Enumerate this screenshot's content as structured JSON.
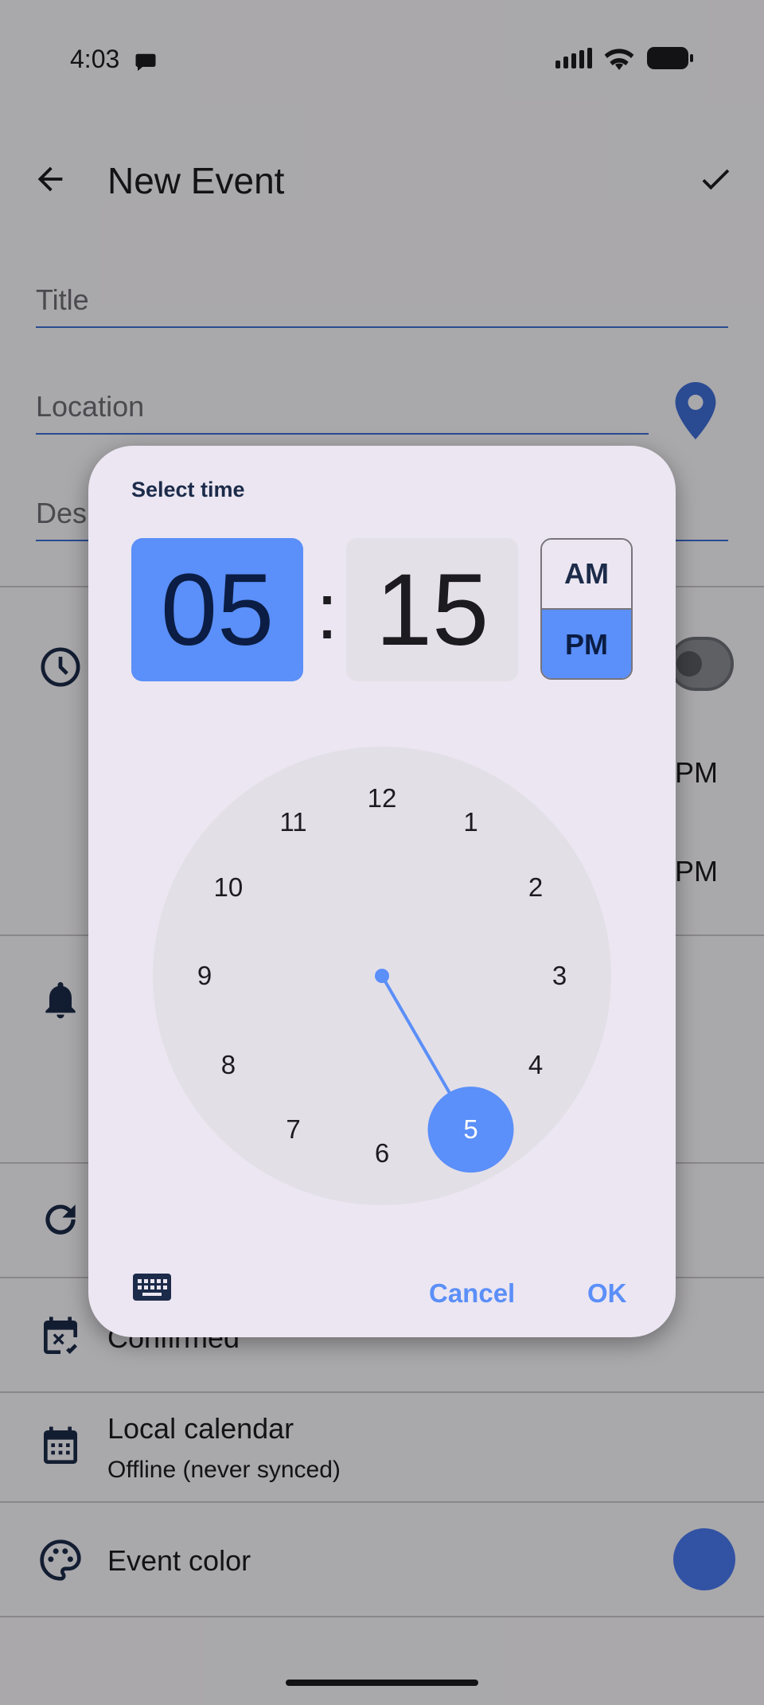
{
  "status_bar": {
    "time": "4:03"
  },
  "app_bar": {
    "title": "New Event"
  },
  "form": {
    "title_placeholder": "Title",
    "location_placeholder": "Location",
    "description_placeholder": "Des"
  },
  "times": {
    "start_suffix": "PM",
    "end_suffix": "PM"
  },
  "status_row": {
    "label": "Confirmed"
  },
  "calendar_row": {
    "title": "Local calendar",
    "subtitle": "Offline (never synced)"
  },
  "color_row": {
    "label": "Event color",
    "color": "#4a7af2"
  },
  "dialog": {
    "title": "Select time",
    "hour": "05",
    "separator": ":",
    "minute": "15",
    "am_label": "AM",
    "pm_label": "PM",
    "period_selected": "PM",
    "clock_numbers": [
      "12",
      "1",
      "2",
      "3",
      "4",
      "5",
      "6",
      "7",
      "8",
      "9",
      "10",
      "11"
    ],
    "selected_hour": 5,
    "cancel_label": "Cancel",
    "ok_label": "OK",
    "accent_color": "#5b8ff9"
  },
  "icons": [
    "back-arrow-icon",
    "check-icon",
    "location-pin-icon",
    "clock-icon",
    "bell-icon",
    "repeat-icon",
    "calendar-check-icon",
    "calendar-grid-icon",
    "palette-icon",
    "keyboard-icon"
  ]
}
